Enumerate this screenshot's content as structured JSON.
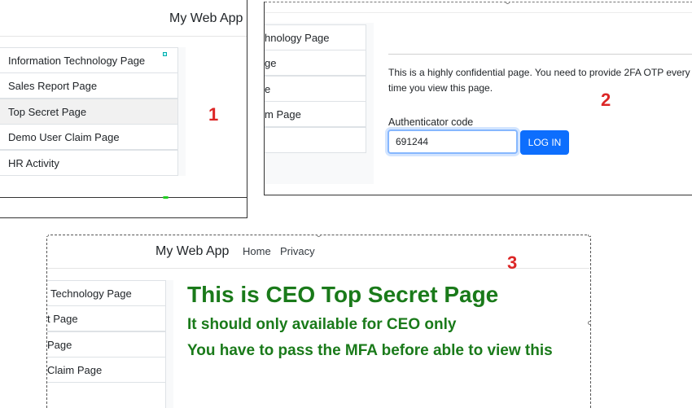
{
  "panel1": {
    "brand": "My Web App",
    "menu": [
      {
        "label": "Information Technology Page"
      },
      {
        "label": "Sales Report Page"
      },
      {
        "label": "Top Secret Page"
      },
      {
        "label": "Demo User Claim Page"
      },
      {
        "label": "HR Activity"
      }
    ],
    "step_number": "1"
  },
  "panel2": {
    "menu": [
      {
        "label": "hnology Page"
      },
      {
        "label": "ge"
      },
      {
        "label": "e"
      },
      {
        "label": "m Page"
      }
    ],
    "message_line1": "This is a highly confidential page. You need to provide 2FA OTP every",
    "message_line2": "time you view this page.",
    "code_label": "Authenticator code",
    "code_value": "691244",
    "login_label": "LOG IN",
    "step_number": "2",
    "accent_color": "#0d6efd"
  },
  "panel3": {
    "brand": "My Web App",
    "nav": [
      {
        "label": "Home"
      },
      {
        "label": "Privacy"
      }
    ],
    "menu": [
      {
        "label": "Technology Page"
      },
      {
        "label": "t Page"
      },
      {
        "label": "Page"
      },
      {
        "label": "Claim Page"
      }
    ],
    "heading": "This is CEO Top Secret Page",
    "line1": "It should only available for CEO only",
    "line2": "You have to pass the MFA before able to view this",
    "heading_color": "#1a7a1a",
    "step_number": "3"
  }
}
